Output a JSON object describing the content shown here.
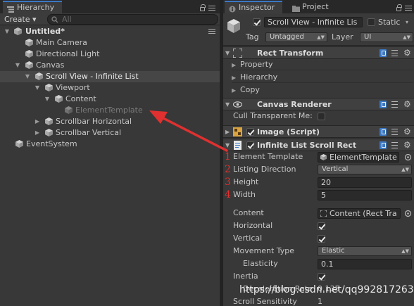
{
  "hierarchy": {
    "tab_label": "Hierarchy",
    "create_label": "Create ▾",
    "search_placeholder": "All",
    "scene_title": "Untitled*",
    "items": [
      {
        "label": "Main Camera"
      },
      {
        "label": "Directional Light"
      },
      {
        "label": "Canvas"
      },
      {
        "label": "Scroll View - Infinite List"
      },
      {
        "label": "Viewport"
      },
      {
        "label": "Content"
      },
      {
        "label": "ElementTemplate"
      },
      {
        "label": "Scrollbar Horizontal"
      },
      {
        "label": "Scrollbar Vertical"
      },
      {
        "label": "EventSystem"
      }
    ]
  },
  "inspector": {
    "tab_inspector": "Inspector",
    "tab_project": "Project",
    "object_name": "Scroll View - Infinite Lis",
    "static_label": "Static",
    "tag_label": "Tag",
    "tag_value": "Untagged",
    "layer_label": "Layer",
    "layer_value": "UI",
    "rect_transform": {
      "title": "Rect Transform",
      "subsections": [
        "Property",
        "Hierarchy",
        "Copy"
      ]
    },
    "canvas_renderer": {
      "title": "Canvas Renderer",
      "cull_label": "Cull Transparent Me:"
    },
    "image_script": {
      "title": "Image (Script)"
    },
    "infinite_list": {
      "title": "Infinite List Scroll Rect",
      "rows": [
        {
          "num": "1",
          "label": "Element Template",
          "value": "ElementTemplate"
        },
        {
          "num": "2",
          "label": "Listing Direction",
          "value": "Vertical"
        },
        {
          "num": "3",
          "label": "Height",
          "value": "20"
        },
        {
          "num": "4",
          "label": "Width",
          "value": "5"
        }
      ],
      "content_label": "Content",
      "content_value": "Content (Rect Tra",
      "horizontal_label": "Horizontal",
      "vertical_label": "Vertical",
      "movement_label": "Movement Type",
      "movement_value": "Elastic",
      "elasticity_label": "Elasticity",
      "elasticity_value": "0.1",
      "inertia_label": "Inertia",
      "decel_label": "Deceleration Rate",
      "decel_value": "0.135",
      "sensitivity_label": "Scroll Sensitivity",
      "sensitivity_value": "1"
    }
  },
  "watermark": "https://blog.csdn.net/qq992817263",
  "colors": {
    "accent": "#3b78c4",
    "annotation": "#e03030"
  }
}
